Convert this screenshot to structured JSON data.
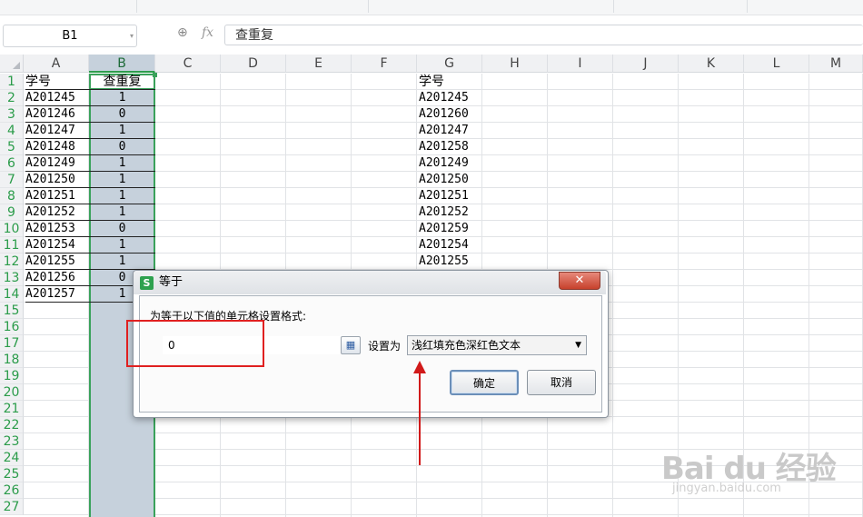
{
  "namebox": {
    "value": "B1"
  },
  "formula_bar": {
    "fx": "fx",
    "value": "查重复"
  },
  "columns": [
    "A",
    "B",
    "C",
    "D",
    "E",
    "F",
    "G",
    "H",
    "I",
    "J",
    "K",
    "L",
    "M"
  ],
  "rows": [
    "1",
    "2",
    "3",
    "4",
    "5",
    "6",
    "7",
    "8",
    "9",
    "10",
    "11",
    "12",
    "13",
    "14",
    "15",
    "16",
    "17",
    "18",
    "19",
    "20",
    "21",
    "22",
    "23",
    "24",
    "25",
    "26",
    "27"
  ],
  "colA": [
    "学号",
    "A201245",
    "A201246",
    "A201247",
    "A201248",
    "A201249",
    "A201250",
    "A201251",
    "A201252",
    "A201253",
    "A201254",
    "A201255",
    "A201256",
    "A201257"
  ],
  "colB": [
    "查重复",
    "1",
    "0",
    "1",
    "0",
    "1",
    "1",
    "1",
    "1",
    "0",
    "1",
    "1",
    "0",
    "1"
  ],
  "colG": [
    "学号",
    "A201245",
    "A201260",
    "A201247",
    "A201258",
    "A201249",
    "A201250",
    "A201251",
    "A201252",
    "A201259",
    "A201254",
    "A201255"
  ],
  "dialog": {
    "title": "等于",
    "logo": "S",
    "close": "✕",
    "label": "为等于以下值的单元格设置格式:",
    "input_value": "0",
    "setas": "设置为",
    "select_value": "浅红填充色深红色文本",
    "ok": "确定",
    "cancel": "取消"
  },
  "watermark": {
    "brand": "Bai du 经验",
    "url": "jingyan.baidu.com"
  }
}
